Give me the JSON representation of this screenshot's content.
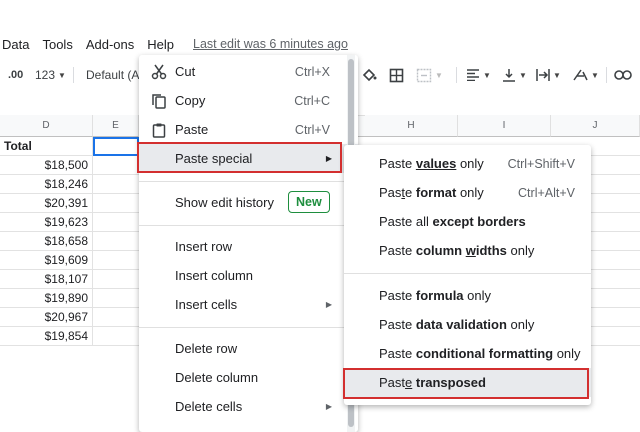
{
  "menubar": {
    "items": [
      "Data",
      "Tools",
      "Add-ons",
      "Help"
    ],
    "last_edit": "Last edit was 6 minutes ago"
  },
  "toolbar": {
    "decimal": ".00",
    "number_format": "123",
    "font": "Default (Ari"
  },
  "columns": [
    "D",
    "E",
    "H",
    "I",
    "J"
  ],
  "sheet": {
    "header_cell": "Total",
    "values": [
      "$18,500",
      "$18,246",
      "$20,391",
      "$19,623",
      "$18,658",
      "$19,609",
      "$18,107",
      "$19,890",
      "$20,967",
      "$19,854"
    ]
  },
  "context_menu": {
    "cut": {
      "label": "Cut",
      "shortcut": "Ctrl+X"
    },
    "copy": {
      "label": "Copy",
      "shortcut": "Ctrl+C"
    },
    "paste": {
      "label": "Paste",
      "shortcut": "Ctrl+V"
    },
    "paste_special": {
      "label": "Paste special"
    },
    "show_edit_history": {
      "label": "Show edit history",
      "badge": "New"
    },
    "insert_row": "Insert row",
    "insert_column": "Insert column",
    "insert_cells": "Insert cells",
    "delete_row": "Delete row",
    "delete_column": "Delete column",
    "delete_cells": "Delete cells"
  },
  "submenu": {
    "values_only": {
      "a": "Paste ",
      "b": "values",
      "c": " only",
      "shortcut": "Ctrl+Shift+V"
    },
    "format_only": {
      "a": "Pas",
      "u": "t",
      "b": "e ",
      "c": "format",
      "d": " only",
      "shortcut": "Ctrl+Alt+V"
    },
    "all_except_borders": {
      "a": "Paste all ",
      "b": "except borders"
    },
    "column_widths": {
      "a": "Paste ",
      "b": "column ",
      "u": "w",
      "c": "idths",
      "d": " only"
    },
    "formula_only": {
      "a": "Paste ",
      "b": "formula",
      "c": " only"
    },
    "data_validation": {
      "a": "Paste ",
      "b": "data validation",
      "c": " only"
    },
    "conditional_formatting": {
      "a": "Paste ",
      "b": "conditional formatting",
      "c": " only"
    },
    "transposed": {
      "a": "Past",
      "u": "e",
      "b": " ",
      "c": "transposed"
    }
  },
  "colors": {
    "highlight_box": "#d32f2f",
    "badge": "#1e8e3e",
    "selection": "#1a73e8"
  }
}
